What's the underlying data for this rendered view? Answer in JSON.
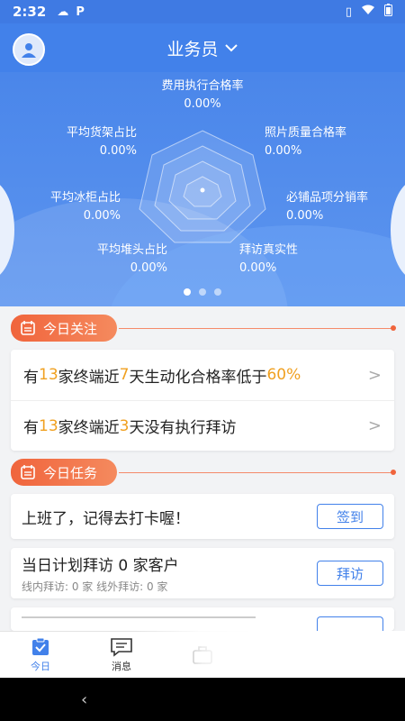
{
  "status_bar": {
    "time": "2:32",
    "app_indicator": "P"
  },
  "header": {
    "title": "业务员"
  },
  "metrics": {
    "top": {
      "label": "费用执行合格率",
      "value": "0.00%"
    },
    "top_right": {
      "label": "照片质量合格率",
      "value": "0.00%"
    },
    "right": {
      "label": "必铺品项分销率",
      "value": "0.00%"
    },
    "bottom_right": {
      "label": "拜访真实性",
      "value": "0.00%"
    },
    "bottom_left": {
      "label": "平均堆头占比",
      "value": "0.00%"
    },
    "left": {
      "label": "平均冰柜占比",
      "value": "0.00%"
    },
    "top_left": {
      "label": "平均货架占比",
      "value": "0.00%"
    }
  },
  "carousel": {
    "pages": 3,
    "active_index": 0
  },
  "attention": {
    "label": "今日关注",
    "row1": {
      "p1": "有",
      "n1": "13",
      "p2": "家终端近",
      "n2": "7",
      "p3": "天生动化合格率低于",
      "n3": "60%"
    },
    "row2": {
      "p1": "有",
      "n1": "13",
      "p2": "家终端近",
      "n2": "3",
      "p3": "天没有执行拜访"
    }
  },
  "tasks": {
    "label": "今日任务",
    "checkin": {
      "title": "上班了，记得去打卡喔！",
      "button": "签到"
    },
    "visit": {
      "title": "当日计划拜访 0 家客户",
      "sub": "线内拜访: 0 家   线外拜访: 0 家",
      "button": "拜访"
    }
  },
  "tabbar": {
    "today": "今日",
    "messages": "消息"
  },
  "colors": {
    "primary": "#4281ea",
    "accent": "#f0643c",
    "highlight": "#f0a020"
  }
}
